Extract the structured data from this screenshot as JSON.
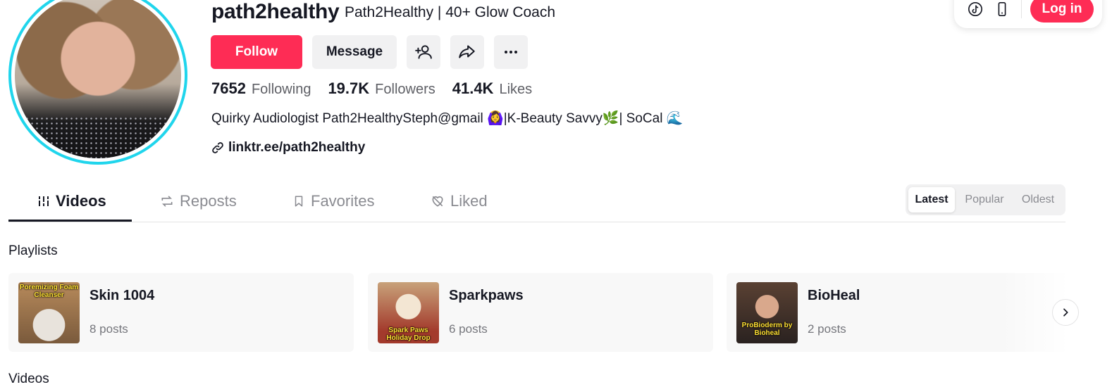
{
  "profile": {
    "username": "path2healthy",
    "nickname": "Path2Healthy | 40+ Glow Coach",
    "bio": "Quirky Audiologist Path2HealthySteph@gmail 🙆‍♀️|K-Beauty Savvy🌿| SoCal 🌊",
    "link": "linktr.ee/path2healthy"
  },
  "actions": {
    "follow": "Follow",
    "message": "Message",
    "add_friend_icon": "person-plus-icon",
    "share_icon": "share-arrow-icon",
    "more_icon": "ellipsis-icon"
  },
  "stats": {
    "following_count": "7652",
    "following_label": "Following",
    "followers_count": "19.7K",
    "followers_label": "Followers",
    "likes_count": "41.4K",
    "likes_label": "Likes"
  },
  "topbar": {
    "login": "Log in",
    "icons": [
      "tiktok-logo-icon",
      "mobile-phone-icon"
    ]
  },
  "tabs": [
    {
      "label": "Videos",
      "icon": "grid-bars-icon",
      "active": true
    },
    {
      "label": "Reposts",
      "icon": "repost-icon",
      "active": false
    },
    {
      "label": "Favorites",
      "icon": "bookmark-icon",
      "active": false
    },
    {
      "label": "Liked",
      "icon": "heart-icon",
      "active": false
    }
  ],
  "sort": {
    "options": [
      "Latest",
      "Popular",
      "Oldest"
    ],
    "selected": "Latest"
  },
  "playlists": {
    "title": "Playlists",
    "items": [
      {
        "name": "Skin 1004",
        "count": "8 posts",
        "thumb_caption": "Poremizing Foam Cleanser"
      },
      {
        "name": "Sparkpaws",
        "count": "6 posts",
        "thumb_caption": "Spark Paws Holiday Drop"
      },
      {
        "name": "BioHeal",
        "count": "2 posts",
        "thumb_caption": "ProBioderm by Bioheal"
      }
    ]
  },
  "videos_section": {
    "title": "Videos"
  },
  "colors": {
    "accent": "#fe2c55",
    "avatar_ring": "#20d5ec",
    "text": "#161823",
    "muted": "#5f6066",
    "button_bg": "#f1f1f2"
  }
}
